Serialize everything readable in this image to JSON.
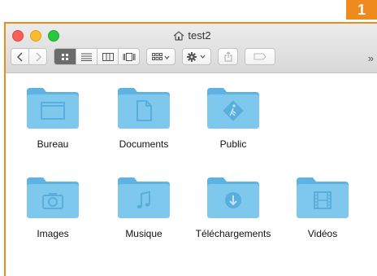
{
  "step_number": "1",
  "window": {
    "title": "test2"
  },
  "toolbar": {
    "overflow": "»"
  },
  "folders": [
    {
      "label": "Bureau",
      "icon": "desktop-glyph"
    },
    {
      "label": "Documents",
      "icon": "document-glyph"
    },
    {
      "label": "Public",
      "icon": "public-glyph"
    },
    {
      "label": "Images",
      "icon": "camera-glyph"
    },
    {
      "label": "Musique",
      "icon": "music-note-glyph"
    },
    {
      "label": "Téléchargements",
      "icon": "download-glyph"
    },
    {
      "label": "Vidéos",
      "icon": "film-glyph"
    }
  ],
  "colors": {
    "accent": "#ef8a1f",
    "folder": "#7ec8ee",
    "folder_dark": "#5eb3e3"
  }
}
